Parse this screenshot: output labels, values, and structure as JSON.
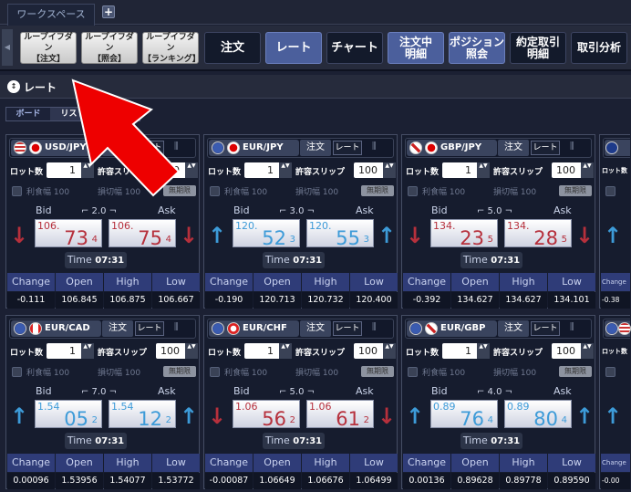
{
  "workspace_tab": "ワークスペース",
  "add_tab": "+",
  "toolbar": {
    "loop_order": [
      "ループイフダン",
      "【注文】"
    ],
    "loop_inquiry": [
      "ループイフダン",
      "【照会】"
    ],
    "loop_ranking": [
      "ループイフダン",
      "【ランキング】"
    ],
    "order": "注文",
    "rate": "レート",
    "chart": "チャート",
    "pending_orders": [
      "注文中",
      "明細"
    ],
    "positions": [
      "ポジション",
      "照会"
    ],
    "executions": [
      "約定取引",
      "明細"
    ],
    "analysis": "取引分析"
  },
  "panel": {
    "title": "レート",
    "view_board": "ボード",
    "view_list": "リスト"
  },
  "labels": {
    "order": "注文",
    "rate": "レート",
    "lot": "ロット数",
    "slip": "許容スリップ",
    "tp": "利食幅",
    "sl": "損切幅",
    "unlimited": "無期限",
    "bid": "Bid",
    "ask": "Ask",
    "time": "Time",
    "change": "Change",
    "open": "Open",
    "high": "High",
    "low": "Low"
  },
  "colors": {
    "up": "#3d9bd8",
    "down": "#b6303c",
    "accent": "#4b5f9c"
  },
  "cards": [
    {
      "pair": "USD/JPY",
      "flags": [
        "us",
        "jp"
      ],
      "lot": "1",
      "slip": "100",
      "tp": "100",
      "sl": "100",
      "spread": "2.0",
      "dir": "down",
      "bid": [
        "106.",
        "73",
        "4"
      ],
      "ask": [
        "106.",
        "75",
        "4"
      ],
      "time": "07:31",
      "change": "-0.111",
      "open": "106.845",
      "high": "106.875",
      "low": "106.667"
    },
    {
      "pair": "EUR/JPY",
      "flags": [
        "eu",
        "jp"
      ],
      "lot": "1",
      "slip": "100",
      "tp": "100",
      "sl": "100",
      "spread": "3.0",
      "dir": "up",
      "bid": [
        "120.",
        "52",
        "3"
      ],
      "ask": [
        "120.",
        "55",
        "3"
      ],
      "time": "07:31",
      "change": "-0.190",
      "open": "120.713",
      "high": "120.732",
      "low": "120.400"
    },
    {
      "pair": "GBP/JPY",
      "flags": [
        "gb",
        "jp"
      ],
      "lot": "1",
      "slip": "100",
      "tp": "100",
      "sl": "100",
      "spread": "5.0",
      "dir": "down",
      "bid": [
        "134.",
        "23",
        "5"
      ],
      "ask": [
        "134.",
        "28",
        "5"
      ],
      "time": "07:31",
      "change": "-0.392",
      "open": "134.627",
      "high": "134.627",
      "low": "134.101"
    },
    {
      "pair": "",
      "flags": [
        "au",
        ""
      ],
      "lot": "",
      "slip": "",
      "tp": "",
      "sl": "",
      "spread": "",
      "dir": "up",
      "bid": [
        "",
        "",
        ""
      ],
      "ask": [
        "",
        "",
        ""
      ],
      "time": "",
      "change": "-0.38",
      "open": "",
      "high": "",
      "low": ""
    },
    {
      "pair": "EUR/CAD",
      "flags": [
        "eu",
        "ca"
      ],
      "lot": "1",
      "slip": "100",
      "tp": "100",
      "sl": "100",
      "spread": "7.0",
      "dir": "up",
      "bid": [
        "1.54",
        "05",
        "2"
      ],
      "ask": [
        "1.54",
        "12",
        "2"
      ],
      "time": "07:31",
      "change": "0.00096",
      "open": "1.53956",
      "high": "1.54077",
      "low": "1.53772"
    },
    {
      "pair": "EUR/CHF",
      "flags": [
        "eu",
        "ch"
      ],
      "lot": "1",
      "slip": "100",
      "tp": "100",
      "sl": "100",
      "spread": "5.0",
      "dir": "down",
      "bid": [
        "1.06",
        "56",
        "2"
      ],
      "ask": [
        "1.06",
        "61",
        "2"
      ],
      "time": "07:31",
      "change": "-0.00087",
      "open": "1.06649",
      "high": "1.06676",
      "low": "1.06499"
    },
    {
      "pair": "EUR/GBP",
      "flags": [
        "eu",
        "gb"
      ],
      "lot": "1",
      "slip": "100",
      "tp": "100",
      "sl": "100",
      "spread": "4.0",
      "dir": "up",
      "bid": [
        "0.89",
        "76",
        "4"
      ],
      "ask": [
        "0.89",
        "80",
        "4"
      ],
      "time": "07:31",
      "change": "0.00136",
      "open": "0.89628",
      "high": "0.89778",
      "low": "0.89590"
    },
    {
      "pair": "",
      "flags": [
        "eu",
        "us"
      ],
      "lot": "",
      "slip": "",
      "tp": "",
      "sl": "",
      "spread": "",
      "dir": "up",
      "bid": [
        "",
        "",
        ""
      ],
      "ask": [
        "",
        "",
        ""
      ],
      "time": "",
      "change": "-0.00",
      "open": "",
      "high": "",
      "low": ""
    }
  ]
}
